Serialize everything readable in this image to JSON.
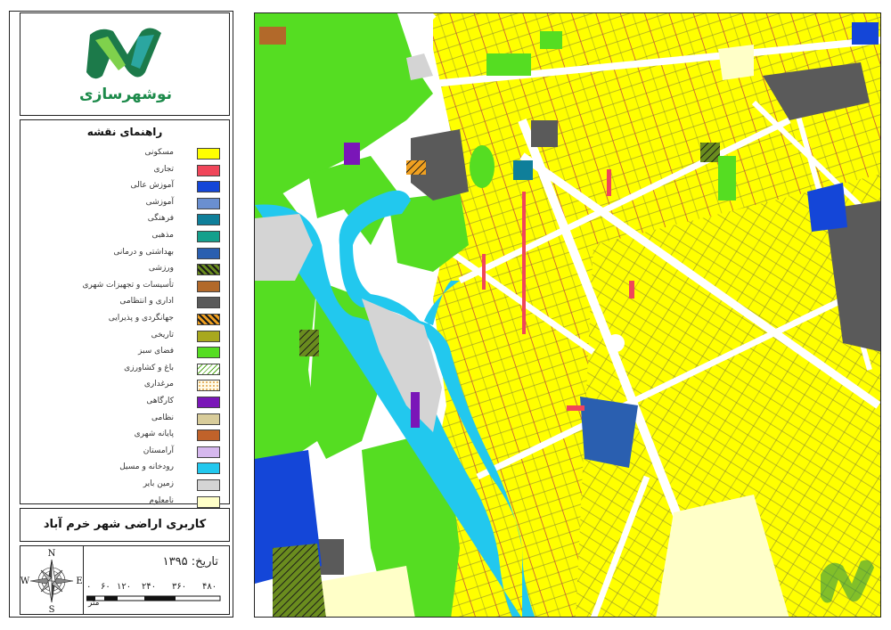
{
  "logo": {
    "text": "نوشهرسازی"
  },
  "legend": {
    "title": "راهنمای نقشه",
    "items": [
      {
        "label": "مسکونی",
        "color": "#ffff00",
        "pattern": "solid"
      },
      {
        "label": "تجاری",
        "color": "#f0465a",
        "pattern": "solid"
      },
      {
        "label": "آموزش عالی",
        "color": "#1446d8",
        "pattern": "solid"
      },
      {
        "label": "آموزشی",
        "color": "#6a8fd0",
        "pattern": "solid"
      },
      {
        "label": "فرهنگی",
        "color": "#0f7f9a",
        "pattern": "solid"
      },
      {
        "label": "مذهبی",
        "color": "#14a08c",
        "pattern": "solid"
      },
      {
        "label": "بهداشتی و درمانی",
        "color": "#2a5fb0",
        "pattern": "solid"
      },
      {
        "label": "ورزشی",
        "color": "#6a8c1e",
        "pattern": "hatch-dark"
      },
      {
        "label": "تأسیسات و تجهیزات شهری",
        "color": "#b2692a",
        "pattern": "solid"
      },
      {
        "label": "اداری و انتظامی",
        "color": "#5a5a5a",
        "pattern": "solid"
      },
      {
        "label": "جهانگردی و پذیرایی",
        "color": "#f0a020",
        "pattern": "hatch-orange"
      },
      {
        "label": "تاریخی",
        "color": "#a8a81e",
        "pattern": "solid"
      },
      {
        "label": "فضای سبز",
        "color": "#55dd22",
        "pattern": "solid"
      },
      {
        "label": "باغ و کشاورزی",
        "color": "#ffffff",
        "pattern": "dash-green"
      },
      {
        "label": "مرغداری",
        "color": "#ffffff",
        "pattern": "dot-orange"
      },
      {
        "label": "کارگاهی",
        "color": "#7a16b8",
        "pattern": "solid"
      },
      {
        "label": "نظامی",
        "color": "#d8cc9a",
        "pattern": "solid"
      },
      {
        "label": "پایانه شهری",
        "color": "#c0622a",
        "pattern": "solid"
      },
      {
        "label": "آرامستان",
        "color": "#d6b8ee",
        "pattern": "solid"
      },
      {
        "label": "رودخانه و مسیل",
        "color": "#22c8ee",
        "pattern": "solid"
      },
      {
        "label": "زمین بایر",
        "color": "#d4d4d4",
        "pattern": "solid"
      },
      {
        "label": "نامعلوم",
        "color": "#ffffc8",
        "pattern": "solid"
      }
    ]
  },
  "map_title": "کاربری اراضی شهر خرم آباد",
  "date_text": "تاریخ: ۱۳۹۵",
  "compass": {
    "n": "N",
    "s": "S",
    "e": "E",
    "w": "W"
  },
  "scale": {
    "labels": [
      "۰",
      "۶۰",
      "۱۲۰",
      "۲۴۰",
      "۳۶۰",
      "۴۸۰"
    ],
    "unit": "متر"
  },
  "colors": {
    "residential": "#ffff00",
    "green_space": "#55dd22",
    "river": "#22c8ee",
    "barren": "#d4d4d4",
    "administrative": "#5a5a5a",
    "higher_education": "#1446d8",
    "health": "#2a5fb0",
    "unknown": "#ffffc8",
    "commercial": "#f0465a",
    "road": "#ffffff"
  }
}
